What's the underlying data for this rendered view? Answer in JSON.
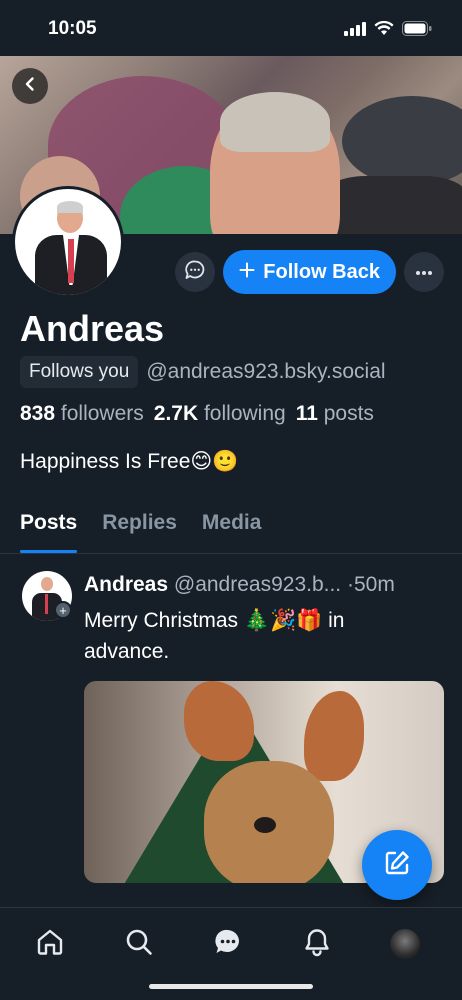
{
  "status_bar": {
    "time": "10:05"
  },
  "profile": {
    "display_name": "Andreas",
    "follows_you_label": "Follows you",
    "handle": "@andreas923.bsky.social",
    "followers_count": "838",
    "followers_label": "followers",
    "following_count": "2.7K",
    "following_label": "following",
    "posts_count": "11",
    "posts_label": "posts",
    "bio": "Happiness Is Free😊🙂",
    "follow_button_label": "Follow Back"
  },
  "tabs": [
    {
      "label": "Posts",
      "active": true
    },
    {
      "label": "Replies",
      "active": false
    },
    {
      "label": "Media",
      "active": false
    }
  ],
  "post": {
    "author_name": "Andreas",
    "author_handle": "@andreas923.b...",
    "separator": "·",
    "time": "50m",
    "text": "Merry Christmas 🎄🎉🎁 in advance."
  },
  "colors": {
    "background": "#161e27",
    "accent": "#1583f6",
    "muted_text": "#a9b4c0"
  },
  "icons": {
    "back": "chevron-left-icon",
    "message": "chat-bubble-icon",
    "follow": "plus-icon",
    "more": "ellipsis-icon",
    "compose": "pencil-square-icon",
    "nav": [
      "home-icon",
      "search-icon",
      "chat-icon",
      "bell-icon",
      "avatar"
    ]
  }
}
